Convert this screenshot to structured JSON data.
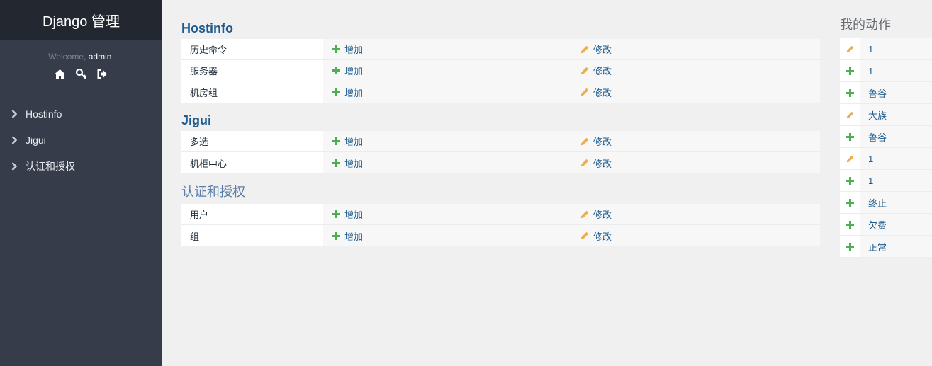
{
  "sidebar": {
    "brand": "Django 管理",
    "welcome_prefix": "Welcome,",
    "username": "admin",
    "welcome_suffix": ".",
    "nav": [
      {
        "label": "Hostinfo"
      },
      {
        "label": "Jigui"
      },
      {
        "label": "认证和授权"
      }
    ]
  },
  "apps": [
    {
      "title": "Hostinfo",
      "models": [
        {
          "name": "历史命令",
          "add": "增加",
          "change": "修改"
        },
        {
          "name": "服务器",
          "add": "增加",
          "change": "修改"
        },
        {
          "name": "机房组",
          "add": "增加",
          "change": "修改"
        }
      ]
    },
    {
      "title": "Jigui",
      "models": [
        {
          "name": "多选",
          "add": "增加",
          "change": "修改"
        },
        {
          "name": "机柜中心",
          "add": "增加",
          "change": "修改"
        }
      ]
    },
    {
      "title": "认证和授权",
      "models": [
        {
          "name": "用户",
          "add": "增加",
          "change": "修改"
        },
        {
          "name": "组",
          "add": "增加",
          "change": "修改"
        }
      ]
    }
  ],
  "actions": {
    "title": "我的动作",
    "items": [
      {
        "icon": "pencil-icon",
        "label": "1"
      },
      {
        "icon": "plus-icon",
        "label": "1"
      },
      {
        "icon": "plus-icon",
        "label": "鲁谷"
      },
      {
        "icon": "pencil-icon",
        "label": "大族"
      },
      {
        "icon": "plus-icon",
        "label": "鲁谷"
      },
      {
        "icon": "pencil-icon",
        "label": "1"
      },
      {
        "icon": "plus-icon",
        "label": "1"
      },
      {
        "icon": "plus-icon",
        "label": "终止"
      },
      {
        "icon": "plus-icon",
        "label": "欠费"
      },
      {
        "icon": "plus-icon",
        "label": "正常"
      }
    ]
  },
  "colors": {
    "sidebar_bg": "#373c4a",
    "brand_bg": "#23272f",
    "link": "#1d5b8e",
    "plus": "#4caf50",
    "pencil": "#f0ad4e"
  }
}
